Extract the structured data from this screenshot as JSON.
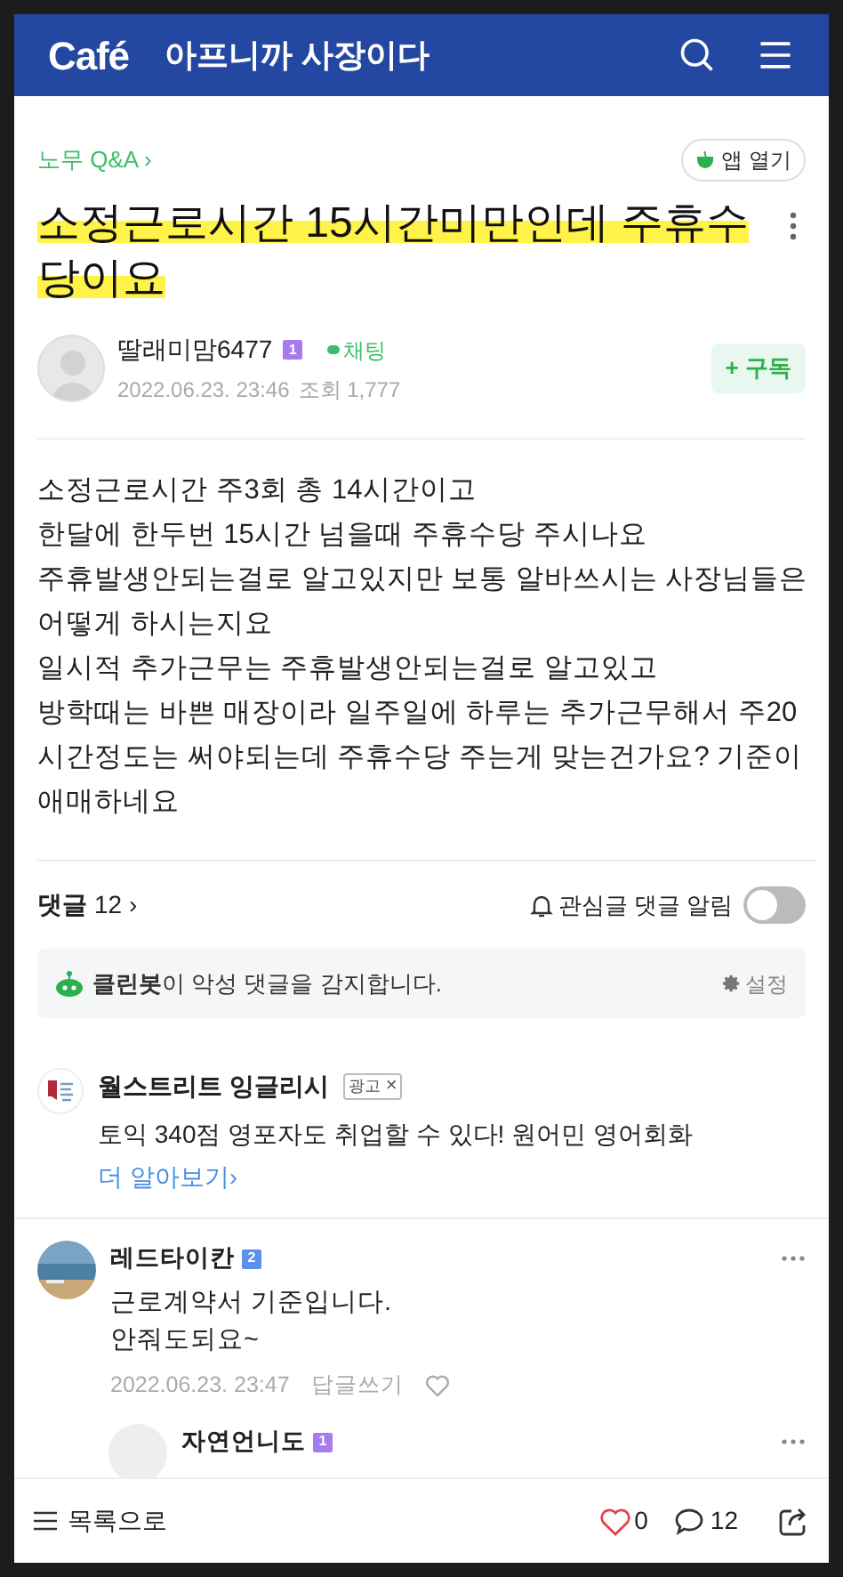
{
  "header": {
    "logo": "Café",
    "cafe_name": "아프니까 사장이다"
  },
  "board": {
    "label": "노무 Q&A",
    "chevron": "›"
  },
  "app_button": {
    "label": "앱 열기"
  },
  "post": {
    "title": "소정근로시간 15시간미만인데 주휴수당이요",
    "author": "딸래미맘6477",
    "level_badge": "1",
    "chat": "채팅",
    "date": "2022.06.23. 23:46",
    "views": "조회 1,777",
    "subscribe": "+ 구독",
    "body": "소정근로시간 주3회 총 14시간이고\n한달에 한두번 15시간 넘을때 주휴수당 주시나요\n주휴발생안되는걸로 알고있지만 보통 알바쓰시는 사장님들은 어떻게 하시는지요\n일시적 추가근무는 주휴발생안되는걸로 알고있고\n방학때는 바쁜 매장이라 일주일에 하루는 추가근무해서 주20시간정도는 써야되는데 주휴수당 주는게 맞는건가요? 기준이 애매하네요"
  },
  "comments_header": {
    "label": "댓글",
    "count": "12",
    "chevron": "›",
    "alert_label": "관심글 댓글 알림",
    "alert_on": false
  },
  "cleanbot": {
    "text": "**클린봇**이 악성 댓글을 감지합니다.",
    "settings": "설정"
  },
  "ad": {
    "name": "월스트리트 잉글리시",
    "badge": "광고",
    "close": "×",
    "text": "토익 340점 영포자도 취업할 수 있다! 원어민 영어회화",
    "link": "더 알아보기›"
  },
  "comments": [
    {
      "author": "레드타이칸",
      "level_badge": "2",
      "text": "근로계약서 기준입니다.\n안줘도되요~",
      "date": "2022.06.23. 23:47",
      "reply": "답글쓰기",
      "liked": false,
      "children": [
        {
          "author": "자연언니도",
          "level_badge": "1"
        }
      ]
    }
  ],
  "bottom_bar": {
    "list": "목록으로",
    "likes": "0",
    "liked": false,
    "comments": "12"
  }
}
